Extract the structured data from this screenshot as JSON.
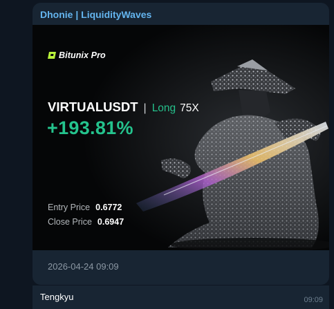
{
  "message": {
    "sender": "Dhonie | LiquidityWaves",
    "caption_timestamp": "2026-04-24 09:09"
  },
  "card": {
    "brand": "Bitunix Pro",
    "pair": "VIRTUALUSDT",
    "separator": "|",
    "direction": "Long",
    "leverage": "75X",
    "pnl": "+193.81%",
    "entry_label": "Entry Price",
    "entry_value": "0.6772",
    "close_label": "Close Price",
    "close_value": "0.6947",
    "accent_color": "#24c38d",
    "artwork": "samurai-figure-with-sword"
  },
  "reply": {
    "text": "Tengkyu",
    "time": "09:09"
  },
  "colors": {
    "background": "#0e1621",
    "bubble": "#182533",
    "sender_name": "#64b5ef"
  }
}
